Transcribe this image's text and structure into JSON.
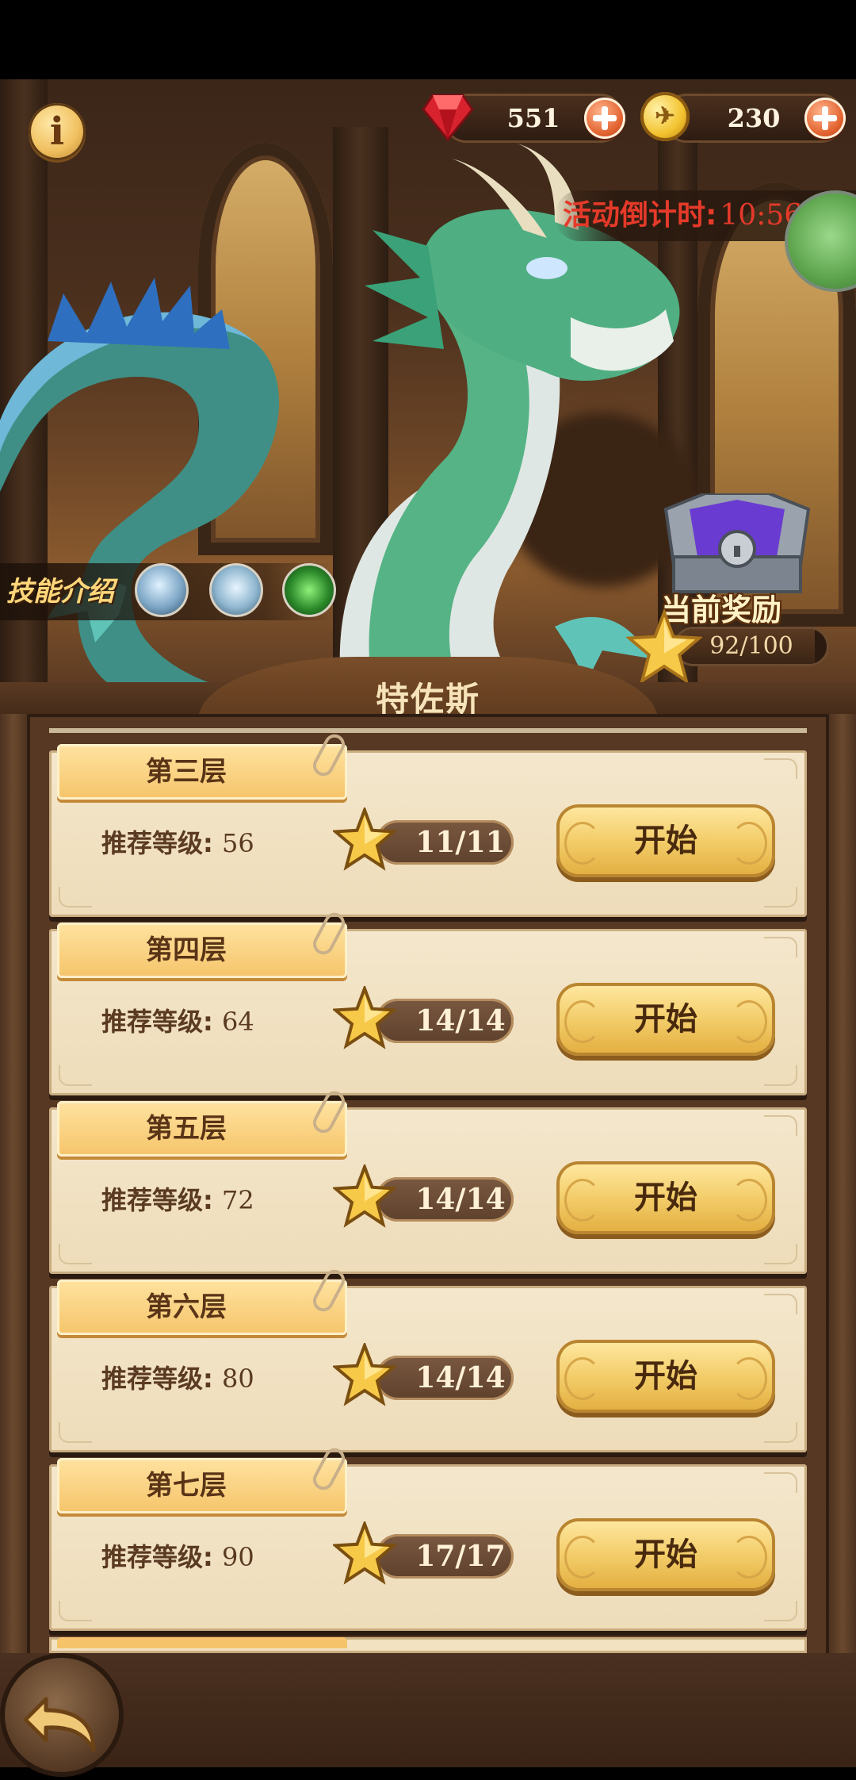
{
  "hud": {
    "info_glyph": "i",
    "gems": "551",
    "coins": "230",
    "coin_glyph": "✈"
  },
  "event": {
    "countdown_label": "活动倒计时:",
    "countdown_time": "10:56:27"
  },
  "skills": {
    "label": "技能介绍",
    "icons": [
      "ice-dragon-skill-icon",
      "frost-dragon-skill-icon",
      "shield-heal-skill-icon"
    ]
  },
  "reward": {
    "title": "当前奖励",
    "progress_text": "92/100",
    "progress_fraction": 0.92
  },
  "boss": {
    "name": "特佐斯"
  },
  "floors": [
    {
      "name": "第三层",
      "level_label": "推荐等级: ",
      "level": "56",
      "stars": "11/11",
      "button": "开始"
    },
    {
      "name": "第四层",
      "level_label": "推荐等级: ",
      "level": "64",
      "stars": "14/14",
      "button": "开始"
    },
    {
      "name": "第五层",
      "level_label": "推荐等级: ",
      "level": "72",
      "stars": "14/14",
      "button": "开始"
    },
    {
      "name": "第六层",
      "level_label": "推荐等级: ",
      "level": "80",
      "stars": "14/14",
      "button": "开始"
    },
    {
      "name": "第七层",
      "level_label": "推荐等级: ",
      "level": "90",
      "stars": "17/17",
      "button": "开始"
    }
  ],
  "colors": {
    "countdown": "#e53a2a",
    "button_gold": "#f3cd6a",
    "card_bg": "#f4e7cc"
  }
}
